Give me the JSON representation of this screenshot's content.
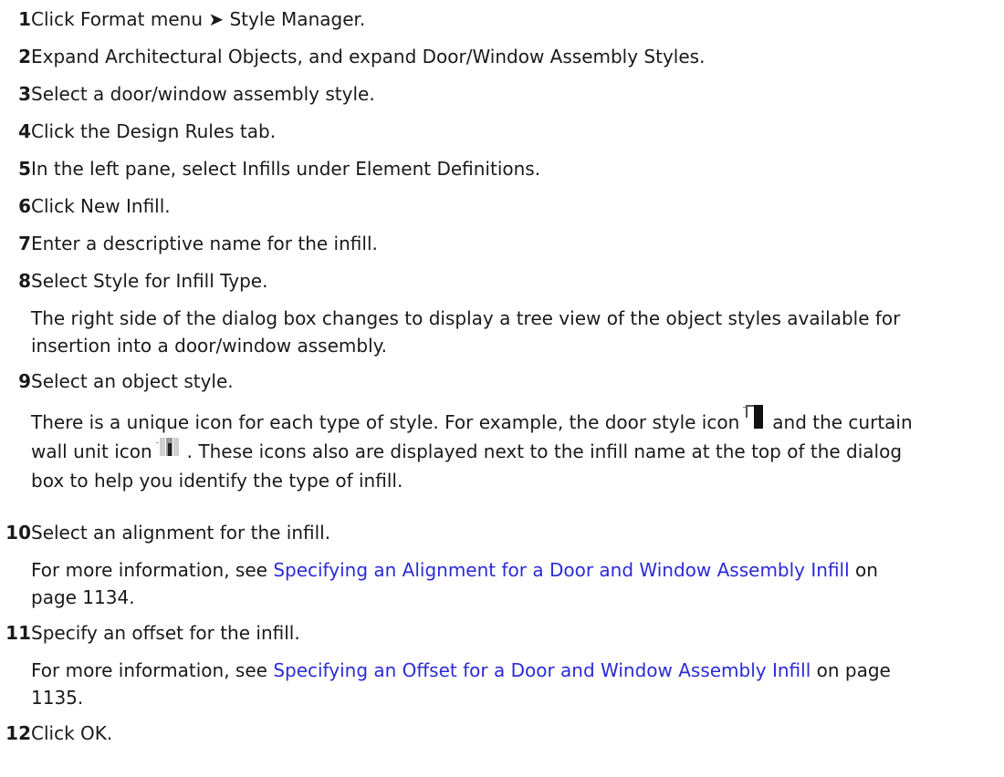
{
  "steps": [
    {
      "num": "1",
      "text": "Click Format menu ➤ Style Manager."
    },
    {
      "num": "2",
      "text": "Expand Architectural Objects, and expand Door/Window Assembly Styles."
    },
    {
      "num": "3",
      "text": "Select a door/window assembly style."
    },
    {
      "num": "4",
      "text": "Click the Design Rules tab."
    },
    {
      "num": "5",
      "text": "In the left pane, select Infills under Element Definitions."
    },
    {
      "num": "6",
      "text": "Click New Infill."
    },
    {
      "num": "7",
      "text": "Enter a descriptive name for the infill."
    },
    {
      "num": "8",
      "text": "Select Style for Infill Type."
    },
    {
      "num": "9",
      "text": "Select an object style."
    },
    {
      "num": "10",
      "text": "Select an alignment for the infill."
    },
    {
      "num": "11",
      "text": "Specify an offset for the infill."
    },
    {
      "num": "12",
      "text": "Click OK."
    }
  ],
  "notes": {
    "step8": {
      "line1": "The right side of the dialog box changes to display a tree view of the object styles available for",
      "line2": "insertion into a door/window assembly."
    },
    "step9": {
      "part1": "There is a unique icon for each type of style. For example, the door style icon",
      "part2": "and the curtain",
      "part3": "wall unit icon",
      "part4": ". These icons also are displayed next to the infill name at the top of the dialog",
      "line3": "box to help you identify the type of infill."
    },
    "step10": {
      "prefix": "For more information, see ",
      "link": "Specifying an Alignment for a Door and Window Assembly Infill",
      "suffix1": " on",
      "line2": "page 1134."
    },
    "step11": {
      "prefix": "For more information, see ",
      "link": "Specifying an Offset for a Door and Window Assembly Infill",
      "suffix1": " on page",
      "line2": "1135."
    }
  },
  "icons": {
    "door_style": "door-style-icon",
    "curtain_wall_unit": "curtain-wall-unit-icon"
  },
  "colors": {
    "text": "#1a1a1a",
    "link": "#2b2bd6"
  }
}
